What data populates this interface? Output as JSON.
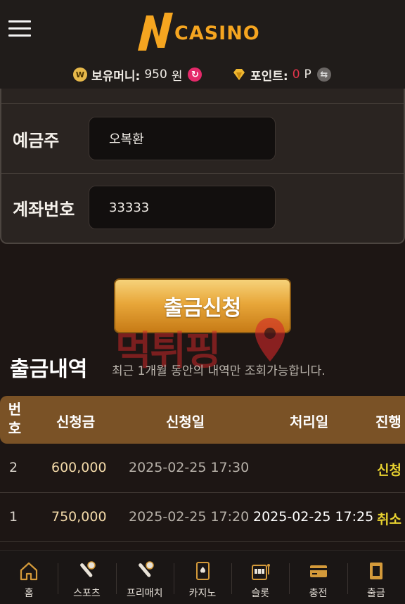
{
  "header": {
    "logo_text": "CASINO",
    "logo_letter": "N"
  },
  "balance": {
    "money_label": "보유머니:",
    "money_value": "950",
    "money_unit": "원",
    "point_label": "포인트:",
    "point_value": "0",
    "point_unit": "P"
  },
  "form": {
    "depositor_label": "예금주",
    "depositor_value": "오복환",
    "account_label": "계좌번호",
    "account_value": "33333"
  },
  "submit_label": "출금신청",
  "watermark_text": "먹튀핑",
  "history": {
    "title": "출금내역",
    "note": "최근 1개월 동안의 내역만 조회가능합니다.",
    "columns": {
      "no_line1": "번",
      "no_line2": "호",
      "amount": "신청금",
      "requested": "신청일",
      "processed": "처리일",
      "status": "진행"
    },
    "rows": [
      {
        "no": "2",
        "amount": "600,000",
        "requested": "2025-02-25 17:30",
        "processed": "",
        "status": "신청"
      },
      {
        "no": "1",
        "amount": "750,000",
        "requested": "2025-02-25 17:20",
        "processed": "2025-02-25 17:25",
        "status": "취소"
      }
    ]
  },
  "nav": {
    "home": "홈",
    "sports": "스포츠",
    "prematch": "프리매치",
    "casino": "카지노",
    "slot": "슬롯",
    "deposit": "충전",
    "withdraw": "출금"
  },
  "colors": {
    "accent_gold": "#f5a520",
    "header_bar": "#7a5226",
    "status_yellow": "#e8d230",
    "point_red": "#e3354b"
  }
}
